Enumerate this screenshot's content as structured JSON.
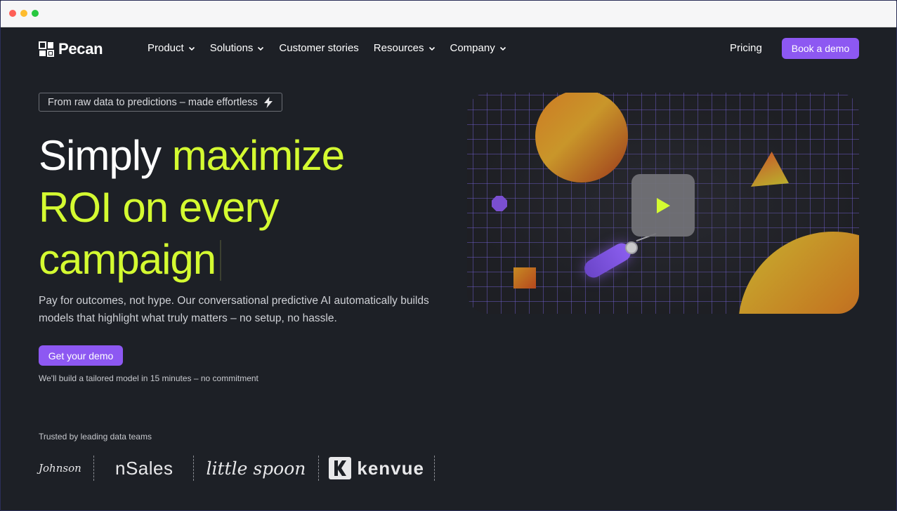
{
  "brand": {
    "name": "Pecan",
    "accent": "#8d58f2",
    "lime": "#d4fb31"
  },
  "nav": {
    "items": [
      {
        "label": "Product",
        "has_dropdown": true
      },
      {
        "label": "Solutions",
        "has_dropdown": true
      },
      {
        "label": "Customer stories",
        "has_dropdown": false
      },
      {
        "label": "Resources",
        "has_dropdown": true
      },
      {
        "label": "Company",
        "has_dropdown": true
      }
    ],
    "pricing": "Pricing",
    "book_demo": "Book a demo"
  },
  "hero": {
    "pill": "From raw data to predictions – made effortless",
    "pill_icon": "lightning-icon",
    "headline_white": "Simply ",
    "headline_lime_1": "maximize",
    "headline_lime_2": "ROI on every",
    "headline_lime_3": "campaign",
    "subtext": "Pay for outcomes, not hype. Our conversational predictive AI automatically builds models that highlight what truly matters – no setup, no hassle.",
    "cta": "Get your demo",
    "cta_note": "We'll build a tailored model in 15 minutes – no commitment"
  },
  "trusted": {
    "label": "Trusted by leading data teams",
    "logos": [
      "Johnson",
      "nSales",
      "little spoon",
      "kenvue"
    ]
  },
  "video": {
    "play_icon": "play-icon"
  }
}
